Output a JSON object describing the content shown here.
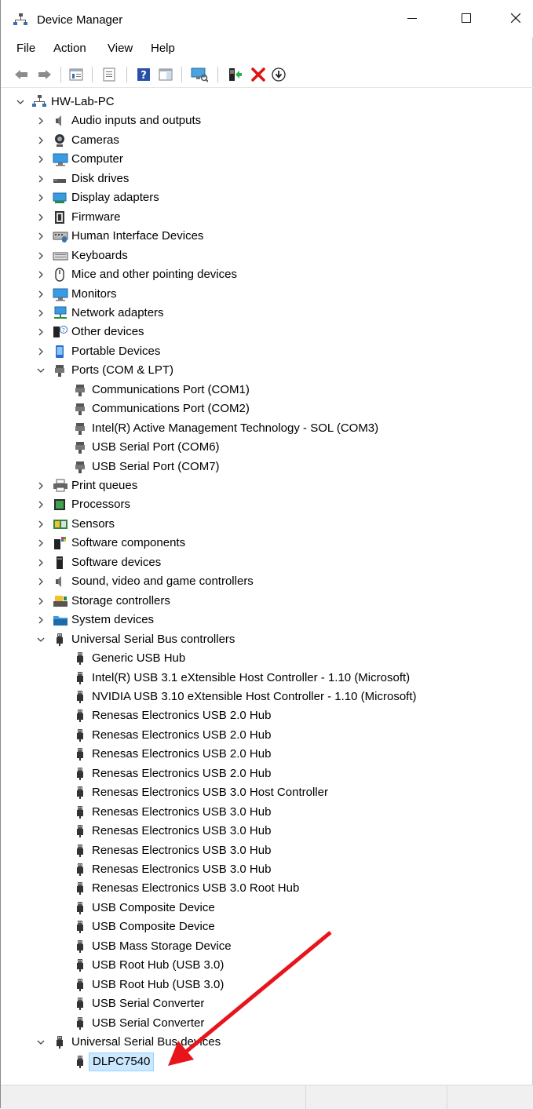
{
  "window": {
    "title": "Device Manager"
  },
  "menu": [
    "File",
    "Action",
    "View",
    "Help"
  ],
  "toolbar": {
    "buttons": [
      "back-icon",
      "forward-icon",
      "properties-icon",
      "show-hidden-icon",
      "help-icon",
      "action-pane-icon",
      "scan-hardware-icon",
      "update-driver-icon",
      "uninstall-icon",
      "download-icon"
    ]
  },
  "tree": {
    "root": "HW-Lab-PC",
    "categories": [
      {
        "label": "Audio inputs and outputs",
        "icon": "speaker-icon",
        "expanded": false
      },
      {
        "label": "Cameras",
        "icon": "camera-icon",
        "expanded": false
      },
      {
        "label": "Computer",
        "icon": "monitor-icon",
        "expanded": false
      },
      {
        "label": "Disk drives",
        "icon": "disk-icon",
        "expanded": false
      },
      {
        "label": "Display adapters",
        "icon": "display-adapter-icon",
        "expanded": false
      },
      {
        "label": "Firmware",
        "icon": "firmware-icon",
        "expanded": false
      },
      {
        "label": "Human Interface Devices",
        "icon": "hid-icon",
        "expanded": false
      },
      {
        "label": "Keyboards",
        "icon": "keyboard-icon",
        "expanded": false
      },
      {
        "label": "Mice and other pointing devices",
        "icon": "mouse-icon",
        "expanded": false
      },
      {
        "label": "Monitors",
        "icon": "monitor-icon",
        "expanded": false
      },
      {
        "label": "Network adapters",
        "icon": "network-icon",
        "expanded": false
      },
      {
        "label": "Other devices",
        "icon": "unknown-device-icon",
        "expanded": false
      },
      {
        "label": "Portable Devices",
        "icon": "portable-device-icon",
        "expanded": false
      },
      {
        "label": "Ports (COM & LPT)",
        "icon": "port-icon",
        "expanded": true,
        "children": [
          "Communications Port (COM1)",
          "Communications Port (COM2)",
          "Intel(R) Active Management Technology - SOL (COM3)",
          "USB Serial Port (COM6)",
          "USB Serial Port (COM7)"
        ]
      },
      {
        "label": "Print queues",
        "icon": "printer-icon",
        "expanded": false
      },
      {
        "label": "Processors",
        "icon": "processor-icon",
        "expanded": false
      },
      {
        "label": "Sensors",
        "icon": "sensor-icon",
        "expanded": false
      },
      {
        "label": "Software components",
        "icon": "software-component-icon",
        "expanded": false
      },
      {
        "label": "Software devices",
        "icon": "software-device-icon",
        "expanded": false
      },
      {
        "label": "Sound, video and game controllers",
        "icon": "speaker-icon",
        "expanded": false
      },
      {
        "label": "Storage controllers",
        "icon": "storage-controller-icon",
        "expanded": false
      },
      {
        "label": "System devices",
        "icon": "system-folder-icon",
        "expanded": false
      },
      {
        "label": "Universal Serial Bus controllers",
        "icon": "usb-icon",
        "expanded": true,
        "children": [
          "Generic USB Hub",
          "Intel(R) USB 3.1 eXtensible Host Controller - 1.10 (Microsoft)",
          "NVIDIA USB 3.10 eXtensible Host Controller - 1.10 (Microsoft)",
          "Renesas Electronics USB 2.0 Hub",
          "Renesas Electronics USB 2.0 Hub",
          "Renesas Electronics USB 2.0 Hub",
          "Renesas Electronics USB 2.0 Hub",
          "Renesas Electronics USB 3.0 Host Controller",
          "Renesas Electronics USB 3.0 Hub",
          "Renesas Electronics USB 3.0 Hub",
          "Renesas Electronics USB 3.0 Hub",
          "Renesas Electronics USB 3.0 Hub",
          "Renesas Electronics USB 3.0 Root Hub",
          "USB Composite Device",
          "USB Composite Device",
          "USB Mass Storage Device",
          "USB Root Hub (USB 3.0)",
          "USB Root Hub (USB 3.0)",
          "USB Serial Converter",
          "USB Serial Converter"
        ]
      },
      {
        "label": "Universal Serial Bus devices",
        "icon": "usb-icon",
        "expanded": true,
        "children": [
          "DLPC7540"
        ],
        "selected_child": 0
      }
    ]
  },
  "annotation": {
    "arrow_color": "#e8141c"
  },
  "colors": {
    "selection": "#cce8ff",
    "selection_border": "#99d1ff"
  }
}
